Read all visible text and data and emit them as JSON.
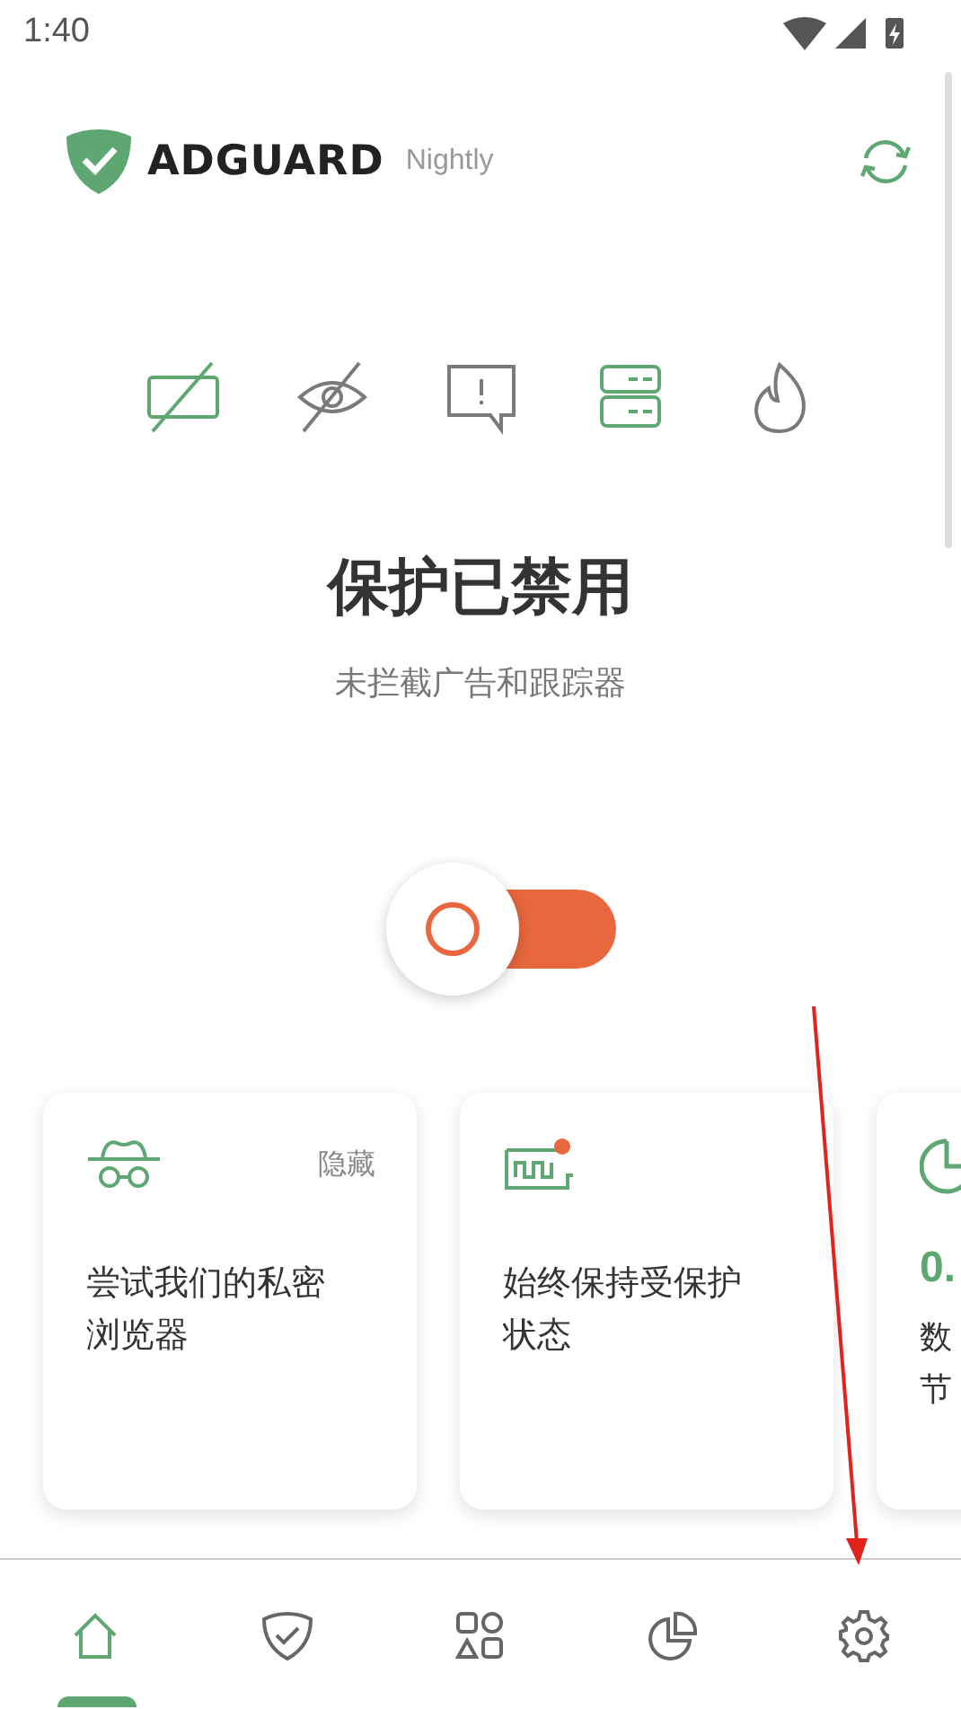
{
  "status_bar": {
    "time": "1:40"
  },
  "header": {
    "brand": "ADGUARD",
    "edition": "Nightly"
  },
  "features": [
    {
      "kind": "ads",
      "active": true
    },
    {
      "kind": "tracking",
      "active": false
    },
    {
      "kind": "annoyances",
      "active": false
    },
    {
      "kind": "dns",
      "active": true
    },
    {
      "kind": "firewall",
      "active": false
    }
  ],
  "protection": {
    "title": "保护已禁用",
    "subtitle": "未拦截广告和跟踪器",
    "on": false
  },
  "cards": [
    {
      "kind": "incognito",
      "action": "隐藏",
      "text": "尝试我们的私密浏览器",
      "badge": false
    },
    {
      "kind": "battery",
      "text": "始终保持受保护状态",
      "badge": true
    },
    {
      "kind": "stats",
      "value": "0.",
      "lines": [
        "数",
        "节"
      ]
    }
  ],
  "nav": [
    {
      "kind": "home",
      "selected": true
    },
    {
      "kind": "shield",
      "selected": false
    },
    {
      "kind": "apps",
      "selected": false
    },
    {
      "kind": "chart",
      "selected": false
    },
    {
      "kind": "settings",
      "selected": false
    }
  ]
}
